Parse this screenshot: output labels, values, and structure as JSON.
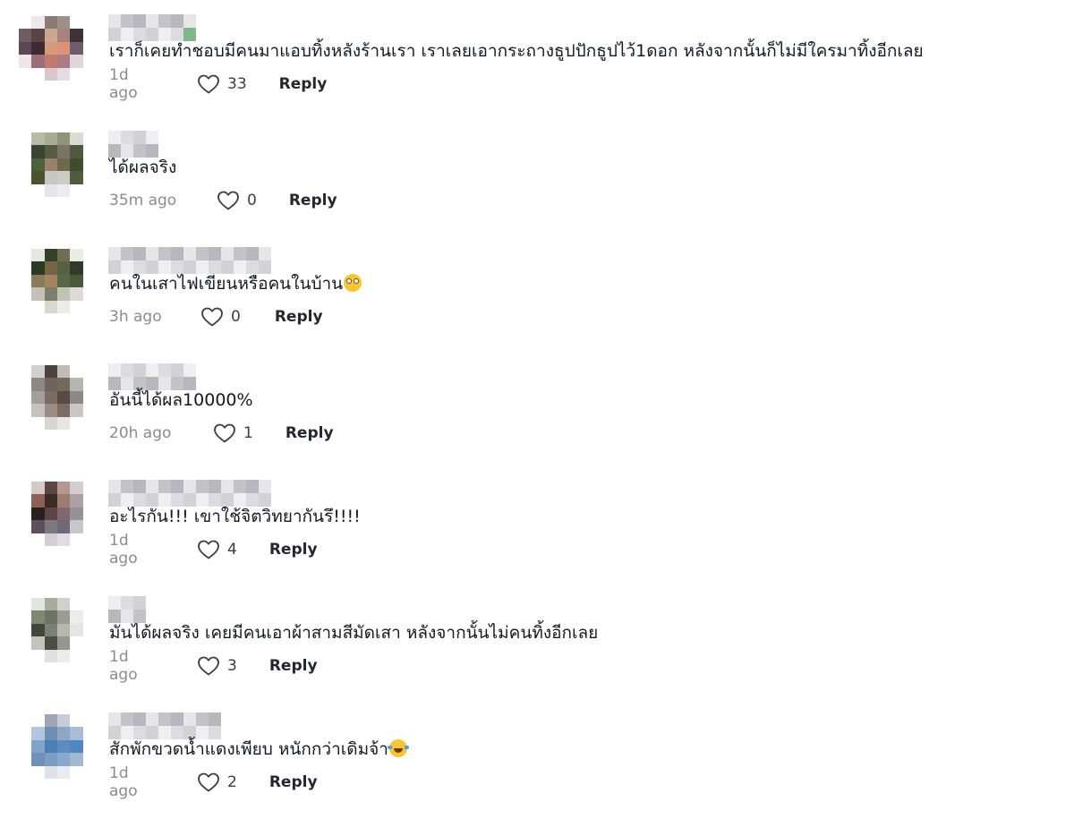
{
  "icons": {
    "like": "heart-outline-icon",
    "emoji_flushed": "flushed-face-emoji",
    "emoji_joy": "face-with-tears-of-joy-emoji"
  },
  "colors": {
    "text": "#161823",
    "meta_text": "#8a8b91",
    "reply_text": "#252630"
  },
  "comments": [
    {
      "text": "เราก็เคยทำชอบมีคนมาแอบทิ้งหลังร้านเรา เราเลยเอากระถางธูปปักธูปไว้1ดอก หลังจากนั้นก็ไม่มีใครมาทิ้งอีกเลย",
      "time": "1d ago",
      "likes": "33",
      "reply": "Reply",
      "emoji": ""
    },
    {
      "text": "ได้ผลจริง",
      "time": "35m ago",
      "likes": "0",
      "reply": "Reply",
      "emoji": ""
    },
    {
      "text": "คนในเสาไฟเขียนหรือคนในบ้าน",
      "time": "3h ago",
      "likes": "0",
      "reply": "Reply",
      "emoji": "flushed"
    },
    {
      "text": "อันนี้ได้ผล10000%",
      "time": "20h ago",
      "likes": "1",
      "reply": "Reply",
      "emoji": ""
    },
    {
      "text": "อะไรกัน!!! เขาใช้จิตวิทยากันรึ!!!!",
      "time": "1d ago",
      "likes": "4",
      "reply": "Reply",
      "emoji": ""
    },
    {
      "text": "มันได้ผลจริง เคยมีคนเอาผ้าสามสีมัดเสา หลังจากนั้นไม่คนทิ้งอีกเลย",
      "time": "1d ago",
      "likes": "3",
      "reply": "Reply",
      "emoji": ""
    },
    {
      "text": "สักพักขวดน้ำแดงเพียบ หนักกว่าเดิมจ้า",
      "time": "1d ago",
      "likes": "2",
      "reply": "Reply",
      "emoji": "joy"
    }
  ]
}
